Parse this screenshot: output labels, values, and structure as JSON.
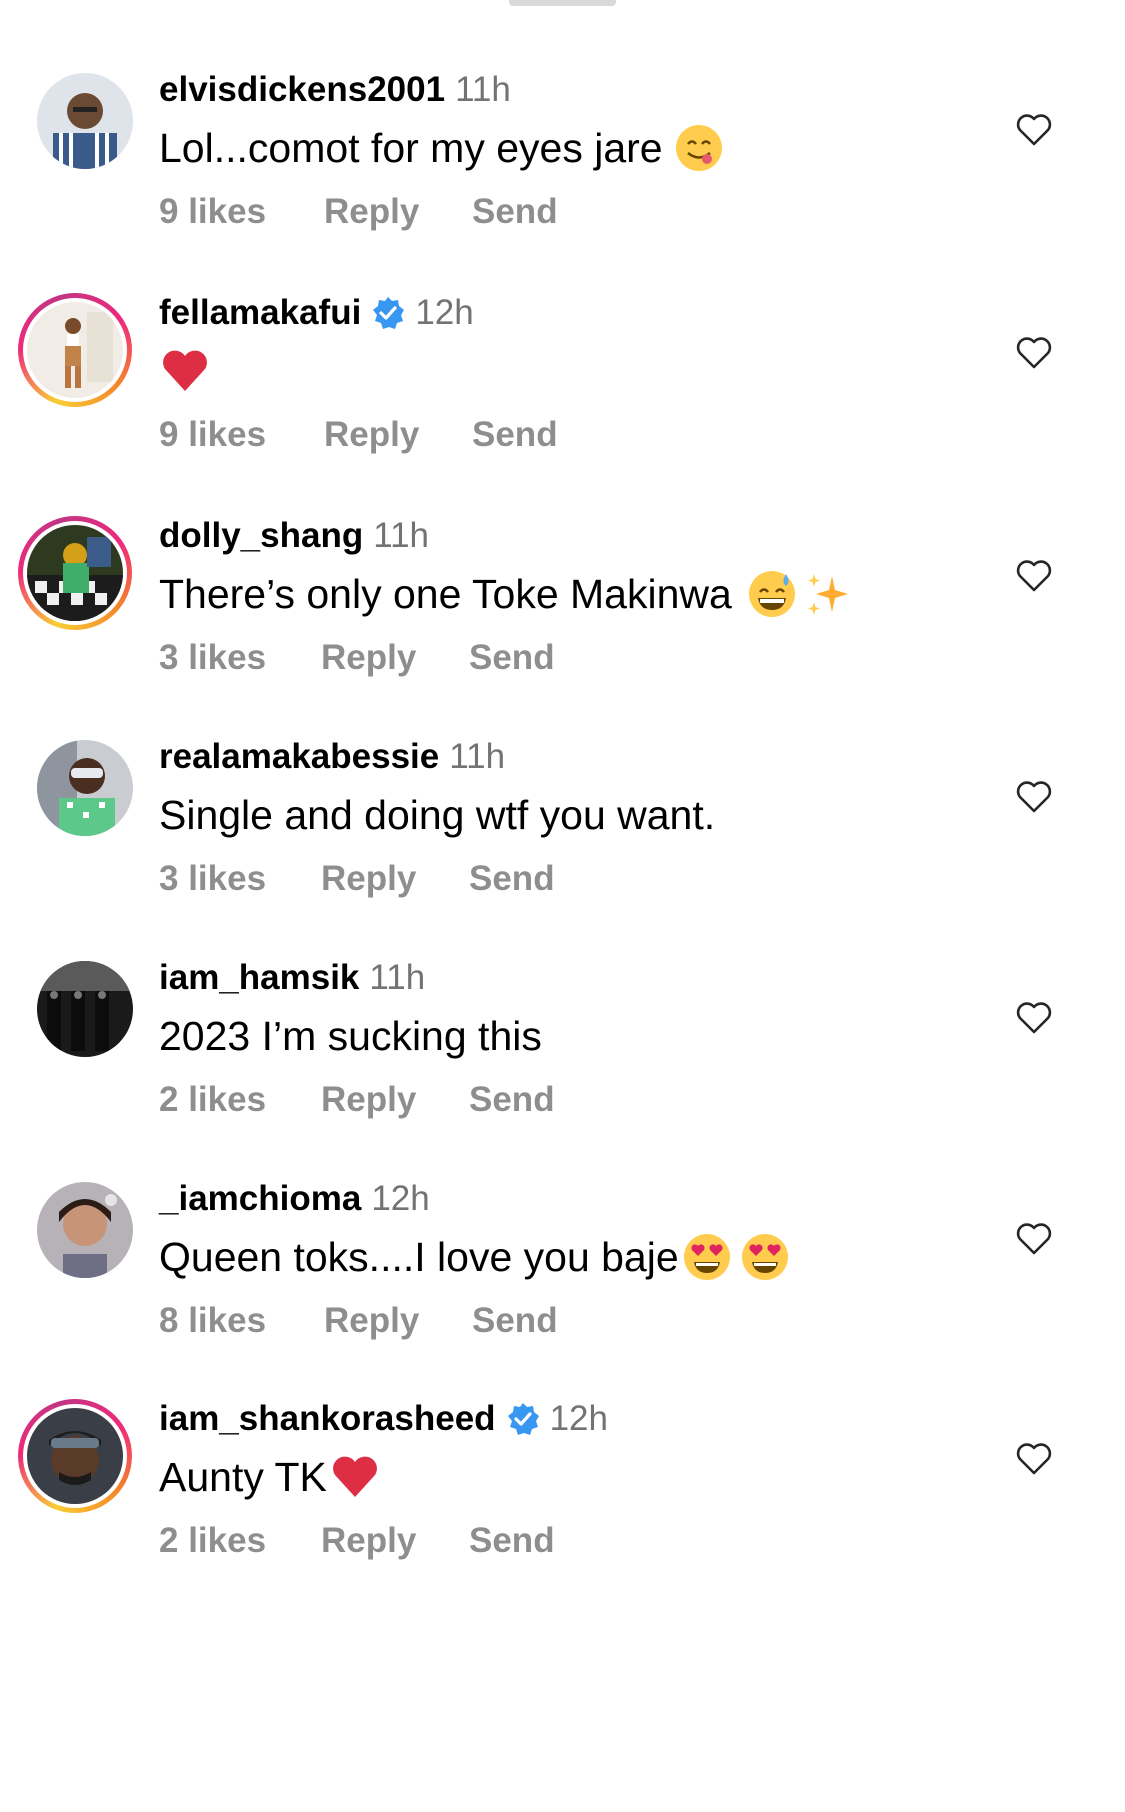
{
  "comments": [
    {
      "username": "elvisdickens2001",
      "verified": false,
      "time": "11h",
      "text": "Lol...comot for my eyes jare",
      "emoji": [
        "yum-face"
      ],
      "likes": "9 likes",
      "reply": "Reply",
      "send": "Send",
      "story_ring": false
    },
    {
      "username": "fellamakafui",
      "verified": true,
      "time": "12h",
      "text": "",
      "emoji": [
        "red-heart"
      ],
      "likes": "9 likes",
      "reply": "Reply",
      "send": "Send",
      "story_ring": true
    },
    {
      "username": "dolly_shang",
      "verified": false,
      "time": "11h",
      "text": "There’s only one Toke Makinwa",
      "emoji": [
        "grinning-sweat-face",
        "sparkles"
      ],
      "likes": "3 likes",
      "reply": "Reply",
      "send": "Send",
      "story_ring": true
    },
    {
      "username": "realamakabessie",
      "verified": false,
      "time": "11h",
      "text": "Single and doing wtf you want.",
      "emoji": [],
      "likes": "3 likes",
      "reply": "Reply",
      "send": "Send",
      "story_ring": false
    },
    {
      "username": "iam_hamsik",
      "verified": false,
      "time": "11h",
      "text": "2023 I’m sucking this",
      "emoji": [],
      "likes": "2 likes",
      "reply": "Reply",
      "send": "Send",
      "story_ring": false
    },
    {
      "username": "_iamchioma",
      "verified": false,
      "time": "12h",
      "text": "Queen toks....I love you baje",
      "emoji": [
        "heart-eyes-face",
        "heart-eyes-face"
      ],
      "likes": "8 likes",
      "reply": "Reply",
      "send": "Send",
      "story_ring": false
    },
    {
      "username": "iam_shankorasheed",
      "verified": true,
      "time": "12h",
      "text": "Aunty TK",
      "emoji": [
        "red-heart"
      ],
      "likes": "2 likes",
      "reply": "Reply",
      "send": "Send",
      "story_ring": true
    }
  ],
  "colors": {
    "text": "#000000",
    "secondary": "#737373",
    "actions": "#8e8e8e",
    "verified_blue": "#3897f0"
  }
}
